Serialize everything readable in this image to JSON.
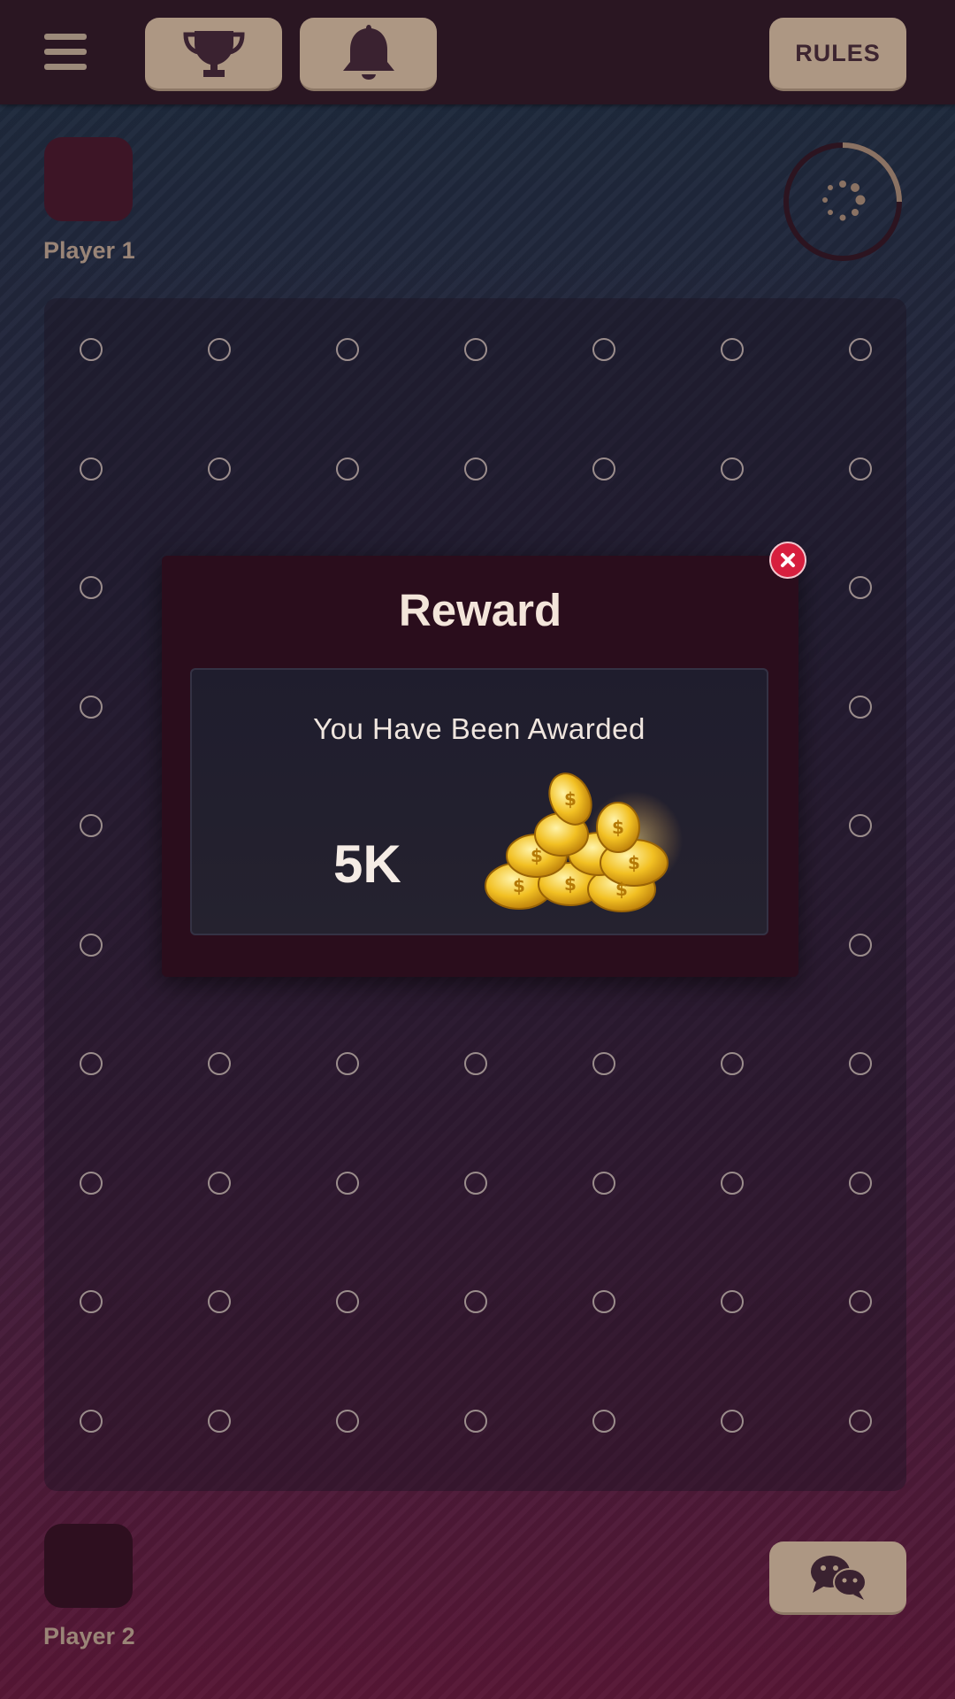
{
  "header": {
    "menu_icon": "hamburger-menu-icon",
    "trophy_icon": "trophy-icon",
    "bell_icon": "bell-icon",
    "rules_label": "RULES"
  },
  "players": {
    "player1": "Player 1",
    "player2": "Player 2"
  },
  "board": {
    "columns": 7,
    "rows": 10
  },
  "timer_icon": "loading-spinner-icon",
  "chat_icon": "chat-bubbles-icon",
  "reward_modal": {
    "title": "Reward",
    "message": "You Have Been Awarded",
    "amount": "5K",
    "coins_icon": "gold-coins-icon",
    "close_icon": "close-icon"
  },
  "colors": {
    "button_bg": "#ad9783",
    "topbar": "#2a1622",
    "modal_bg": "#2a0d1c",
    "close": "#d71f3e"
  }
}
